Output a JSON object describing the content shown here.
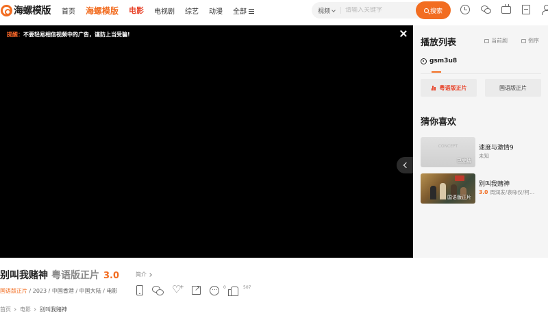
{
  "header": {
    "logo_text": "海螺模版",
    "nav": {
      "home": "首页",
      "brand": "海螺模版",
      "movie": "电影",
      "tv": "电视剧",
      "variety": "综艺",
      "anime": "动漫",
      "all": "全部"
    },
    "search": {
      "type": "视频",
      "placeholder": "请输入关键字",
      "button": "搜索"
    },
    "icons": [
      "clock-icon",
      "wechat-icon",
      "tv-icon",
      "document-icon",
      "avatar-icon"
    ]
  },
  "player": {
    "notice_label": "提醒：",
    "notice_text": "不要轻易相信视频中的广告，谨防上当受骗!"
  },
  "playlist": {
    "title": "播放列表",
    "current_label": "当前剧",
    "sort_label": "倒序",
    "source": "gsm3u8",
    "episodes": [
      "粤语版正片",
      "国语版正片"
    ],
    "active_episode": 0
  },
  "recommend": {
    "title": "猜你喜欢",
    "items": [
      {
        "title": "速度与激情9",
        "subtitle": "未知",
        "badge": "已完结",
        "watermark": "CONCEPT",
        "score": ""
      },
      {
        "title": "别叫我赌神",
        "subtitle": "周润发/袁咏仪/柯…",
        "badge": "国语版正片",
        "score": "3.0"
      }
    ]
  },
  "info": {
    "title": "别叫我赌神",
    "version": "粤语版正片",
    "score": "3.0",
    "intro": "简介",
    "meta_tag": "国语版正片",
    "meta_rest": " / 2023 / 中国香港 / 中国大陆 / 电影",
    "comment_count": "0",
    "like_count": "507"
  },
  "breadcrumb": [
    "首页",
    "电影",
    "别叫我赌神"
  ],
  "colors": {
    "accent": "#f26d21",
    "active_red": "#e8452c"
  }
}
